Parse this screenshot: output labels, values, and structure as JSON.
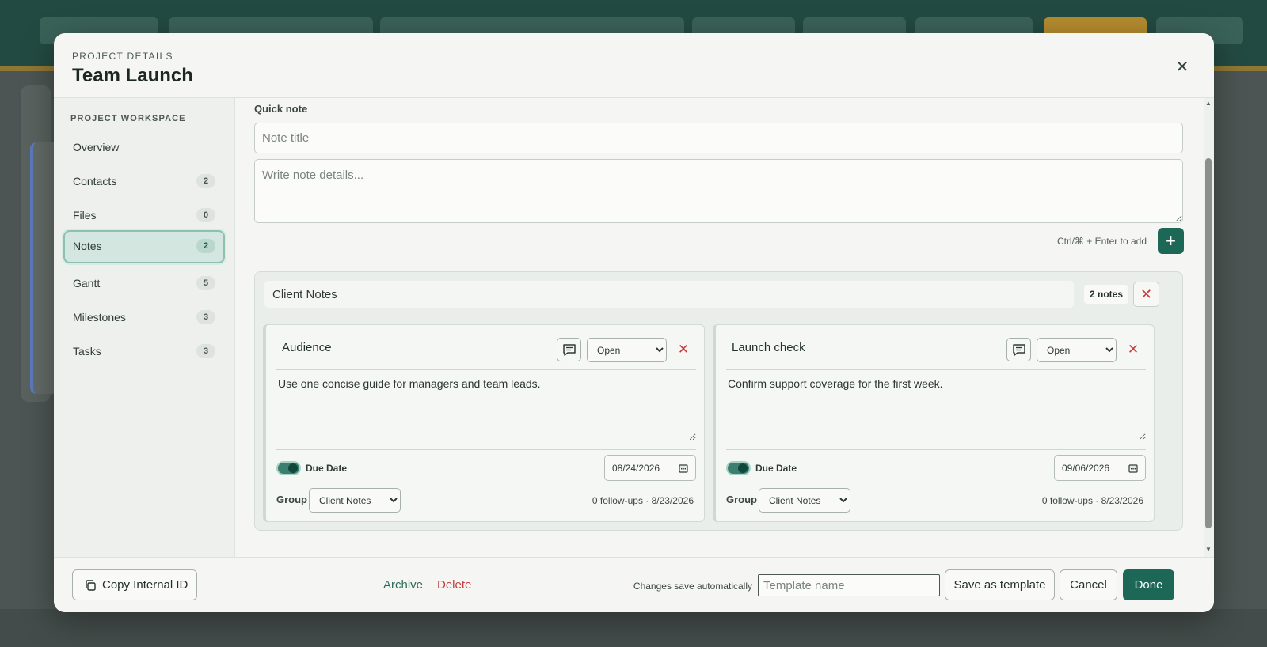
{
  "colors": {
    "brand": "#1d6757",
    "danger": "#c43c3c",
    "active_nav_bg": "#d3e7e0",
    "accent_gold": "#b48b2e"
  },
  "modal": {
    "eyebrow": "PROJECT DETAILS",
    "title": "Team Launch",
    "close_icon": "close-icon"
  },
  "sidebar": {
    "heading": "PROJECT WORKSPACE",
    "items": [
      {
        "label": "Overview",
        "badge": null,
        "active": false
      },
      {
        "label": "Contacts",
        "badge": "2",
        "active": false
      },
      {
        "label": "Files",
        "badge": "0",
        "active": false
      },
      {
        "label": "Notes",
        "badge": "2",
        "active": true
      },
      {
        "label": "Gantt",
        "badge": "5",
        "active": false
      },
      {
        "label": "Milestones",
        "badge": "3",
        "active": false
      },
      {
        "label": "Tasks",
        "badge": "3",
        "active": false
      }
    ]
  },
  "quick_note": {
    "label": "Quick note",
    "title_placeholder": "Note title",
    "title_value": "",
    "body_placeholder": "Write note details...",
    "body_value": "",
    "shortcut_hint": "Ctrl/⌘ + Enter to add",
    "add_label": "+"
  },
  "group": {
    "name": "Client Notes",
    "count_label": "2 notes",
    "remove_label": "✕",
    "notes": [
      {
        "title": "Audience",
        "status": "Open",
        "status_options": [
          "Open"
        ],
        "body": "Use one concise guide for managers and team leads.",
        "due_date_label": "Due Date",
        "due_date_enabled": true,
        "due_date": "08/24/2026",
        "group_label": "Group",
        "group_value": "Client Notes",
        "group_options": [
          "Client Notes"
        ],
        "meta": "0 follow-ups · 8/23/2026",
        "remove_label": "✕"
      },
      {
        "title": "Launch check",
        "status": "Open",
        "status_options": [
          "Open"
        ],
        "body": "Confirm support coverage for the first week.",
        "due_date_label": "Due Date",
        "due_date_enabled": true,
        "due_date": "09/06/2026",
        "group_label": "Group",
        "group_value": "Client Notes",
        "group_options": [
          "Client Notes"
        ],
        "meta": "0 follow-ups · 8/23/2026",
        "remove_label": "✕"
      }
    ]
  },
  "footer": {
    "copy_id_label": "Copy Internal ID",
    "archive_label": "Archive",
    "delete_label": "Delete",
    "autosave_text": "Changes save automatically",
    "template_placeholder": "Template name",
    "save_template_label": "Save as template",
    "cancel_label": "Cancel",
    "done_label": "Done"
  },
  "scrollbar": {
    "up_arrow": "▲",
    "down_arrow": "▼"
  },
  "icons": {
    "comment": "comment-icon",
    "calendar": "calendar-icon",
    "copy": "copy-icon"
  }
}
